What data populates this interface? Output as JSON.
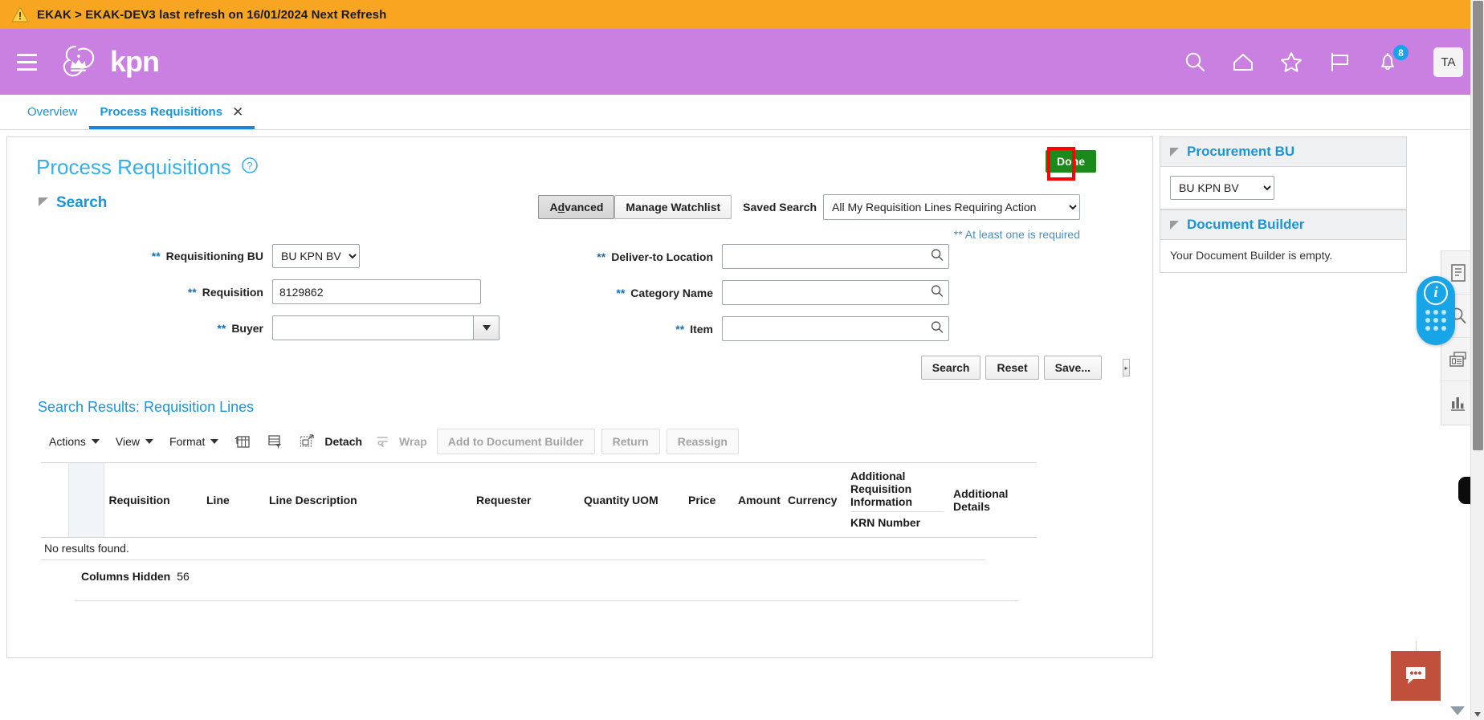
{
  "alert": {
    "icon": "warning-triangle-icon",
    "text": "EKAK > EKAK-DEV3 last refresh on 16/01/2024 Next Refresh"
  },
  "header": {
    "menu_icon": "hamburger-menu-icon",
    "brand": "kpn",
    "icons": [
      {
        "name": "search-icon"
      },
      {
        "name": "home-icon"
      },
      {
        "name": "favorites-star-icon"
      },
      {
        "name": "flag-icon"
      },
      {
        "name": "notifications-bell-icon",
        "badge": "8"
      }
    ],
    "avatar_initials": "TA",
    "bg_color": "#ca80e0",
    "badge_color": "#19a2e8"
  },
  "tabs": [
    {
      "label": "Overview",
      "active": false,
      "closable": false
    },
    {
      "label": "Process Requisitions",
      "active": true,
      "closable": true,
      "close_glyph": "✕"
    }
  ],
  "page": {
    "title": "Process Requisitions",
    "help_icon": "help-question-icon",
    "done_button": "Done",
    "highlight_color": "#ff0000",
    "done_color": "#1a8a1a"
  },
  "search": {
    "section_label": "Search",
    "advanced_button": "Advanced",
    "advanced_accesskey": "d",
    "manage_watchlist_button": "Manage Watchlist",
    "saved_search_label": "Saved Search",
    "saved_search_value": "All My Requisition Lines Requiring Action",
    "saved_search_options": [
      "All My Requisition Lines Requiring Action"
    ],
    "required_note": "** At least one is required",
    "required_marker": "**",
    "fields_left": [
      {
        "label": "Requisitioning BU",
        "type": "select",
        "value": "BU KPN BV",
        "required": true
      },
      {
        "label": "Requisition",
        "type": "text",
        "value": "8129862",
        "required": true
      },
      {
        "label": "Buyer",
        "type": "combo",
        "value": "",
        "required": true
      }
    ],
    "fields_right": [
      {
        "label": "Deliver-to Location",
        "type": "lov",
        "value": "",
        "required": true,
        "icon": "search-icon"
      },
      {
        "label": "Category Name",
        "type": "lov",
        "value": "",
        "required": true,
        "icon": "search-icon"
      },
      {
        "label": "Item",
        "type": "lov",
        "value": "",
        "required": true,
        "icon": "search-icon"
      }
    ],
    "buttons": [
      {
        "label": "Search",
        "name": "search-button"
      },
      {
        "label": "Reset",
        "name": "reset-button"
      },
      {
        "label": "Save...",
        "name": "save-button"
      }
    ],
    "splitter_glyph": "▸"
  },
  "results": {
    "title": "Search Results: Requisition Lines",
    "toolbar": {
      "menus": [
        {
          "label": "Actions",
          "name": "actions-menu"
        },
        {
          "label": "View",
          "name": "view-menu"
        },
        {
          "label": "Format",
          "name": "format-menu"
        }
      ],
      "icons": [
        {
          "name": "freeze-columns-icon"
        },
        {
          "name": "filter-icon"
        },
        {
          "name": "detach-icon"
        }
      ],
      "detach_label": "Detach",
      "wrap_label": "Wrap",
      "wrap_icon": "wrap-icon",
      "buttons": [
        {
          "label": "Add to Document Builder",
          "name": "add-to-document-builder-button",
          "disabled": true
        },
        {
          "label": "Return",
          "name": "return-button",
          "disabled": true
        },
        {
          "label": "Reassign",
          "name": "reassign-button",
          "disabled": true
        }
      ]
    },
    "columns": [
      "Requisition",
      "Line",
      "Line Description",
      "Requester",
      "Quantity",
      "UOM",
      "Price",
      "Amount",
      "Currency"
    ],
    "group_column": {
      "header": "Additional Requisition Information",
      "subheader": "KRN Number"
    },
    "last_column": "Additional Details",
    "empty_message": "No results found.",
    "columns_hidden_label": "Columns Hidden",
    "columns_hidden_count": "56"
  },
  "right_panel": {
    "procurement_bu": {
      "title": "Procurement BU",
      "value": "BU KPN BV",
      "options": [
        "BU KPN BV"
      ]
    },
    "document_builder": {
      "title": "Document Builder",
      "empty_message": "Your Document Builder is empty."
    }
  },
  "right_rail": {
    "icons": [
      {
        "name": "document-icon"
      },
      {
        "name": "search-icon"
      },
      {
        "name": "report-icon"
      },
      {
        "name": "bar-chart-icon"
      }
    ],
    "info_pill": {
      "name": "info-pill",
      "glyph": "i",
      "color": "#18a5e8"
    }
  },
  "chat": {
    "name": "chat-widget-button",
    "icon": "chat-bubble-icon",
    "color": "#c0503c"
  }
}
